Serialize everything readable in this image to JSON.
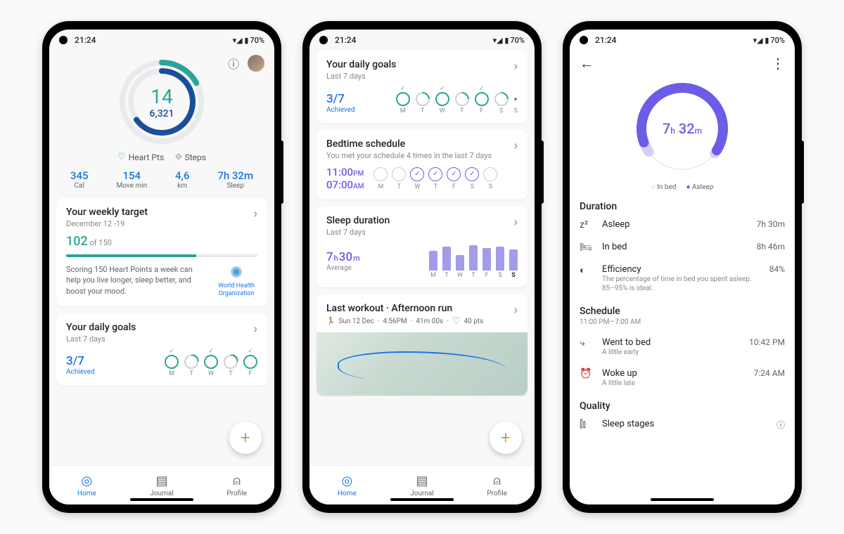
{
  "status": {
    "time": "21:24",
    "battery": "70%"
  },
  "colors": {
    "teal": "#2ba597",
    "blue": "#1a73e8",
    "purple": "#6c5ce7"
  },
  "screen1": {
    "ring": {
      "heartPts": "14",
      "steps": "6,321"
    },
    "legend": {
      "heart": "Heart Pts",
      "steps": "Steps"
    },
    "stats": [
      {
        "v": "345",
        "l": "Cal"
      },
      {
        "v": "154",
        "l": "Move min"
      },
      {
        "v": "4,6",
        "l": "km"
      },
      {
        "v": "7h 32m",
        "l": "Sleep"
      }
    ],
    "weeklyTarget": {
      "title": "Your weekly target",
      "sub": "December 12 -19",
      "progress": "102",
      "of": " of 150",
      "pct": 68,
      "text": "Scoring 150 Heart Points a week can help you live longer, sleep better, and boost your mood.",
      "who": "World Health Organization"
    },
    "dailyGoals": {
      "title": "Your daily goals",
      "sub": "Last 7 days",
      "achieved": "3/7",
      "achievedL": "Achieved",
      "days": [
        "M",
        "T",
        "W",
        "T",
        "F"
      ]
    }
  },
  "screen2": {
    "dailyGoals": {
      "title": "Your daily goals",
      "sub": "Last 7 days",
      "achieved": "3/7",
      "achievedL": "Achieved",
      "days": [
        "M",
        "T",
        "W",
        "T",
        "F",
        "S",
        "S"
      ],
      "status": [
        "full",
        "half",
        "full",
        "half",
        "full",
        "half",
        "dot"
      ]
    },
    "bedtime": {
      "title": "Bedtime schedule",
      "sub": "You met your schedule 4 times in the last 7 days",
      "start": "11:00",
      "startP": "PM",
      "end": "07:00",
      "endP": "AM",
      "days": [
        "M",
        "T",
        "W",
        "T",
        "F",
        "S",
        "S"
      ],
      "checks": [
        false,
        false,
        true,
        true,
        true,
        true,
        false
      ]
    },
    "sleep": {
      "title": "Sleep duration",
      "sub": "Last 7 days",
      "avgH": "7",
      "avgM": "30",
      "avgL": "Average",
      "days": [
        "M",
        "T",
        "W",
        "T",
        "F",
        "S",
        "S"
      ],
      "bars": [
        28,
        34,
        22,
        36,
        32,
        34,
        30
      ]
    },
    "workout": {
      "title": "Last workout · Afternoon run",
      "date": "Sun 12 Dec",
      "time": "4:56PM",
      "dur": "41m 00s",
      "pts": "40 pts"
    }
  },
  "screen3": {
    "sleepTime": {
      "h": "7",
      "m": "32"
    },
    "legend": {
      "inbed": "In bed",
      "asleep": "Asleep"
    },
    "duration": {
      "title": "Duration",
      "rows": [
        {
          "ic": "z",
          "t": "Asleep",
          "v": "7h 30m"
        },
        {
          "ic": "bed",
          "t": "In bed",
          "v": "8h 46m"
        },
        {
          "ic": "eff",
          "t": "Efficiency",
          "s": "The percentage of time in bed you spent asleep. 85–95% is ideal.",
          "v": "84%"
        }
      ]
    },
    "schedule": {
      "title": "Schedule",
      "sub": "11:00 PM—7:00 AM",
      "rows": [
        {
          "ic": "bed2",
          "t": "Went to bed",
          "s": "A little early",
          "v": "10:42 PM"
        },
        {
          "ic": "alarm",
          "t": "Woke up",
          "s": "A little late",
          "v": "7:24 AM"
        }
      ]
    },
    "quality": {
      "title": "Quality",
      "row": "Sleep stages"
    }
  },
  "nav": {
    "home": "Home",
    "journal": "Journal",
    "profile": "Profile"
  },
  "chart_data": {
    "type": "bar",
    "title": "Sleep duration – Last 7 days",
    "categories": [
      "M",
      "T",
      "W",
      "T",
      "F",
      "S",
      "S"
    ],
    "values": [
      28,
      34,
      22,
      36,
      32,
      34,
      30
    ],
    "ylabel": "relative bar height"
  }
}
